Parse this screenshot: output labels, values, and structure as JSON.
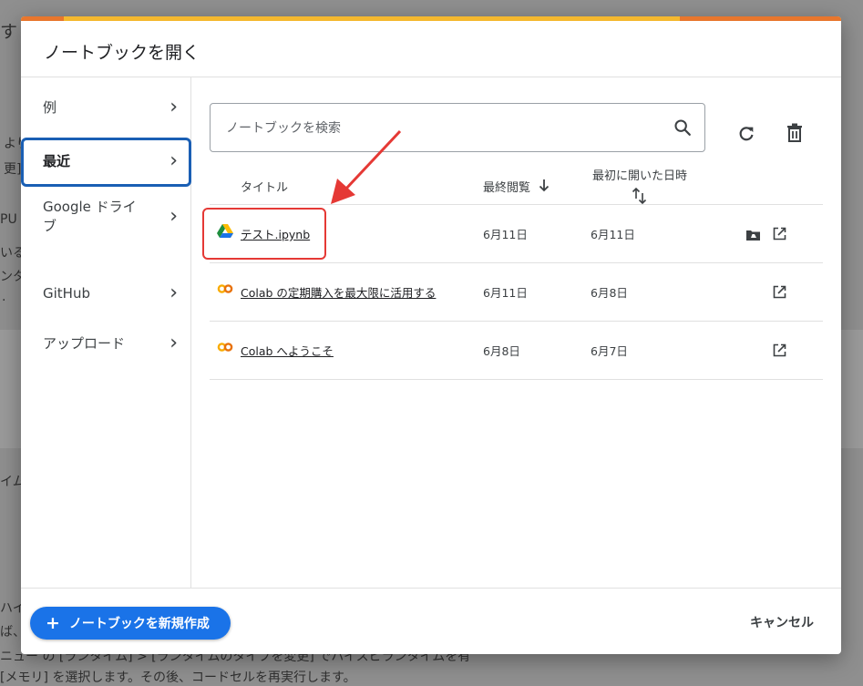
{
  "background": {
    "fragments": [
      "す",
      "より",
      "更]",
      "PU",
      "いる",
      "ンタ",
      ".",
      "イム",
      "ハイ",
      "ば、",
      "ニュー の [ランタイム] > [ランタイムのタイプを変更] でハイスピランタイムを有",
      "[メモリ] を選択します。その後、コードセルを再実行します。"
    ]
  },
  "dialog": {
    "title": "ノートブックを開く",
    "sidebar": {
      "items": [
        {
          "label": "例"
        },
        {
          "label": "最近"
        },
        {
          "label": "Google ドライブ"
        },
        {
          "label": "GitHub"
        },
        {
          "label": "アップロード"
        }
      ]
    },
    "search": {
      "placeholder": "ノートブックを検索",
      "value": ""
    },
    "table": {
      "headers": {
        "title": "タイトル",
        "last_viewed": "最終閲覧",
        "first_opened": "最初に開いた日時"
      },
      "rows": [
        {
          "title": "テスト.ipynb",
          "last_viewed": "6月11日",
          "first_opened": "6月11日",
          "icon": "google-drive-icon"
        },
        {
          "title": "Colab の定期購入を最大限に活用する",
          "last_viewed": "6月11日",
          "first_opened": "6月8日",
          "icon": "colab-icon"
        },
        {
          "title": "Colab へようこそ",
          "last_viewed": "6月8日",
          "first_opened": "6月7日",
          "icon": "colab-icon"
        }
      ]
    },
    "new_notebook_label": "ノートブックを新規作成",
    "new_notebook_plus": "+",
    "cancel_label": "キャンセル"
  },
  "colors": {
    "accent": "#1a73e8",
    "selected_border": "#1a5fb4",
    "annotation_red": "#e53935",
    "top_bar_yellow": "#f5b82e",
    "top_bar_orange": "#e8762d"
  }
}
